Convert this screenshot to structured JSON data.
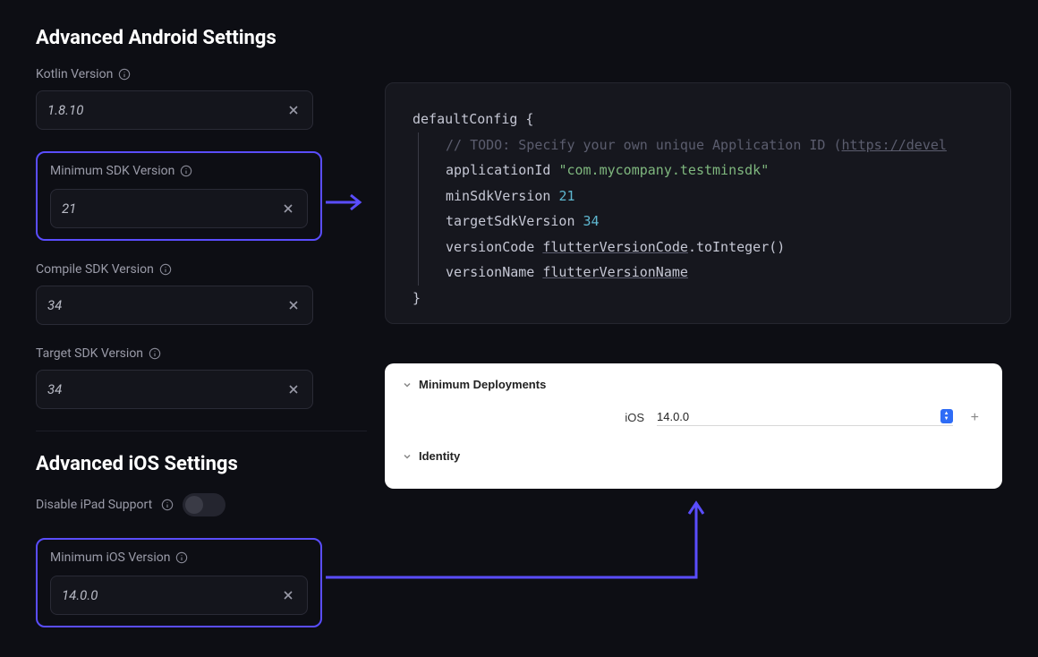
{
  "android": {
    "title": "Advanced Android Settings",
    "kotlin": {
      "label": "Kotlin Version",
      "value": "1.8.10"
    },
    "minsdk": {
      "label": "Minimum SDK Version",
      "value": "21"
    },
    "compilesdk": {
      "label": "Compile SDK Version",
      "value": "34"
    },
    "targetsdk": {
      "label": "Target SDK Version",
      "value": "34"
    }
  },
  "ios": {
    "title": "Advanced iOS Settings",
    "disable_ipad": {
      "label": "Disable iPad Support"
    },
    "minversion": {
      "label": "Minimum iOS Version",
      "value": "14.0.0"
    }
  },
  "code": {
    "line1": "defaultConfig {",
    "comment": "// TODO: Specify your own unique Application ID (",
    "comment_link": "https://devel",
    "appid_key": "applicationId",
    "appid_val": "\"com.mycompany.testminsdk\"",
    "minsdk_key": "minSdkVersion",
    "minsdk_val": "21",
    "targetsdk_key": "targetSdkVersion",
    "targetsdk_val": "34",
    "versioncode_key": "versionCode",
    "versioncode_val": "flutterVersionCode",
    "versioncode_tail": ".toInteger()",
    "versionname_key": "versionName",
    "versionname_val": "flutterVersionName",
    "close": "}"
  },
  "xcode": {
    "section1": "Minimum Deployments",
    "field_label": "iOS",
    "field_value": "14.0.0",
    "section2": "Identity"
  }
}
